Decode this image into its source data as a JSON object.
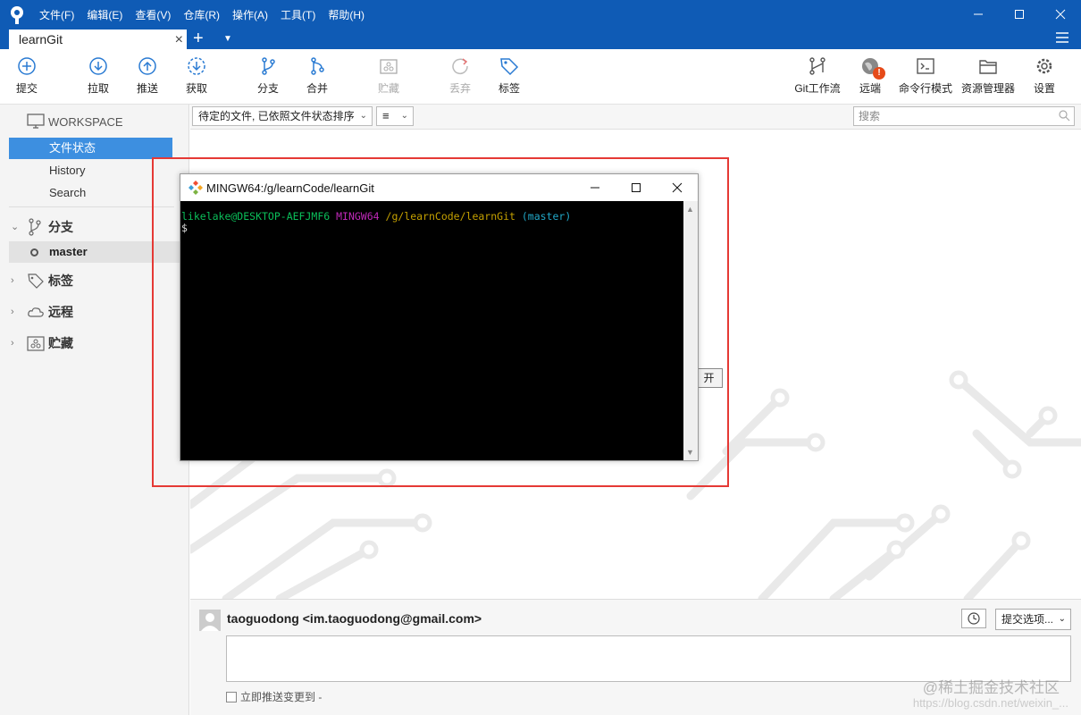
{
  "titlebar": {
    "menu": [
      "文件(F)",
      "编辑(E)",
      "查看(V)",
      "仓库(R)",
      "操作(A)",
      "工具(T)",
      "帮助(H)"
    ],
    "tab_label": "learnGit",
    "accent": "#0f5bb5"
  },
  "toolbar": {
    "commit": "提交",
    "pull": "拉取",
    "push": "推送",
    "fetch": "获取",
    "branch": "分支",
    "merge": "合并",
    "stash": "贮藏",
    "discard": "丢弃",
    "tag": "标签",
    "gitflow": "Git工作流",
    "remote": "远端",
    "remote_badge": "!",
    "terminal": "命令行模式",
    "explorer": "资源管理器",
    "settings": "设置"
  },
  "sidebar": {
    "workspace": "WORKSPACE",
    "items": [
      "文件状态",
      "History",
      "Search"
    ],
    "branches": "分支",
    "current_branch": "master",
    "tags": "标签",
    "remotes": "远程",
    "stashes": "贮藏"
  },
  "filter": {
    "sort_label": "待定的文件, 已依照文件状态排序",
    "view_icon": "≡",
    "search_placeholder": "搜索"
  },
  "main": {
    "partial_button": "开"
  },
  "terminal": {
    "title": "MINGW64:/g/learnCode/learnGit",
    "prompt_user": "likelake@DESKTOP-AEFJMF6",
    "prompt_env": "MINGW64",
    "prompt_path": "/g/learnCode/learnGit",
    "prompt_branch": "(master)",
    "prompt_symbol": "$"
  },
  "commit": {
    "author": "taoguodong <im.taoguodong@gmail.com>",
    "options": "提交选项...",
    "push_immediately": "立即推送变更到 -",
    "watermark": "@稀土掘金技术社区",
    "watermark_url": "https://blog.csdn.net/weixin_..."
  }
}
